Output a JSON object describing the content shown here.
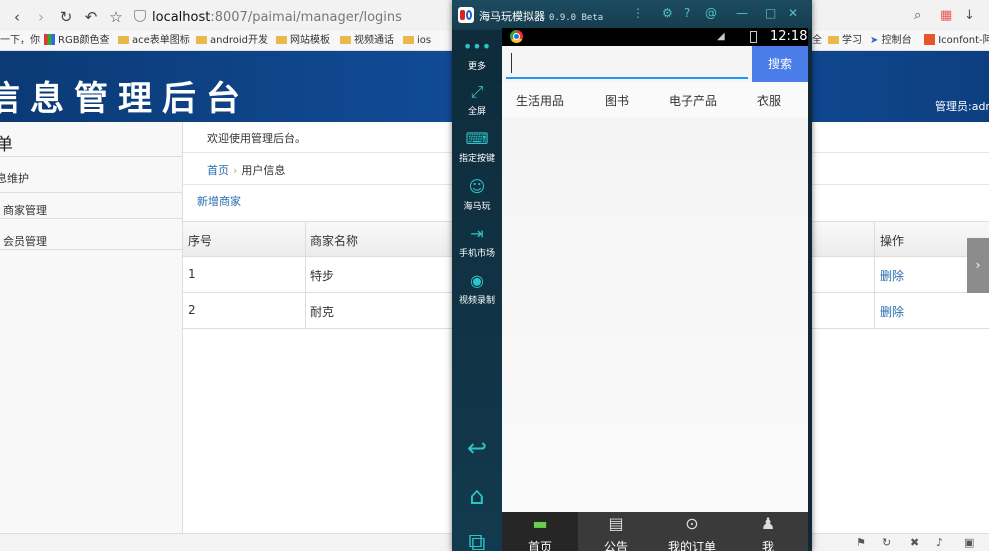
{
  "browser": {
    "url_host": "localhost",
    "url_path": ":8007/paimai/manager/logins",
    "bookmarks": [
      {
        "label": "一下，你"
      },
      {
        "label": "RGB颜色查"
      },
      {
        "label": "ace表单图标"
      },
      {
        "label": "android开发"
      },
      {
        "label": "网站模板"
      },
      {
        "label": "视频通话"
      },
      {
        "label": "ios"
      },
      {
        "label": "全"
      },
      {
        "label": "学习"
      },
      {
        "label": "控制台"
      },
      {
        "label": "Iconfont-阿"
      }
    ]
  },
  "admin": {
    "header_title": "信息管理后台",
    "admin_label": "管理员:adm",
    "sidebar_title": "单",
    "sidebar_section": "息维护",
    "sidebar_items": [
      {
        "label": "商家管理"
      },
      {
        "label": "会员管理"
      }
    ],
    "welcome": "欢迎使用管理后台。",
    "breadcrumb": {
      "home": "首页",
      "current": "用户信息"
    },
    "add_link": "新增商家",
    "table": {
      "headers": [
        "序号",
        "商家名称",
        "操作"
      ],
      "rows": [
        {
          "index": "1",
          "name": "特步",
          "action": "删除"
        },
        {
          "index": "2",
          "name": "耐克",
          "action": "删除"
        }
      ]
    }
  },
  "emulator": {
    "title": "海马玩模拟器",
    "version": "0.9.0 Beta",
    "tools": [
      {
        "label": "更多"
      },
      {
        "label": "全屏"
      },
      {
        "label": "指定按键"
      },
      {
        "label": "海马玩"
      },
      {
        "label": "手机市场"
      },
      {
        "label": "视频录制"
      }
    ],
    "phone": {
      "time": "12:18",
      "search_value": "",
      "search_button": "搜索",
      "categories": [
        "生活用品",
        "图书",
        "电子产品",
        "衣服"
      ],
      "tabs": [
        {
          "label": "首页"
        },
        {
          "label": "公告"
        },
        {
          "label": "我的订单"
        },
        {
          "label": "我"
        }
      ]
    }
  },
  "colors": {
    "header_blue": "#0d3f80",
    "link_blue": "#2a6db0",
    "search_blue": "#4a7de8",
    "emulator_dark": "#0f2936",
    "active_tab_green": "#6ad04a"
  }
}
